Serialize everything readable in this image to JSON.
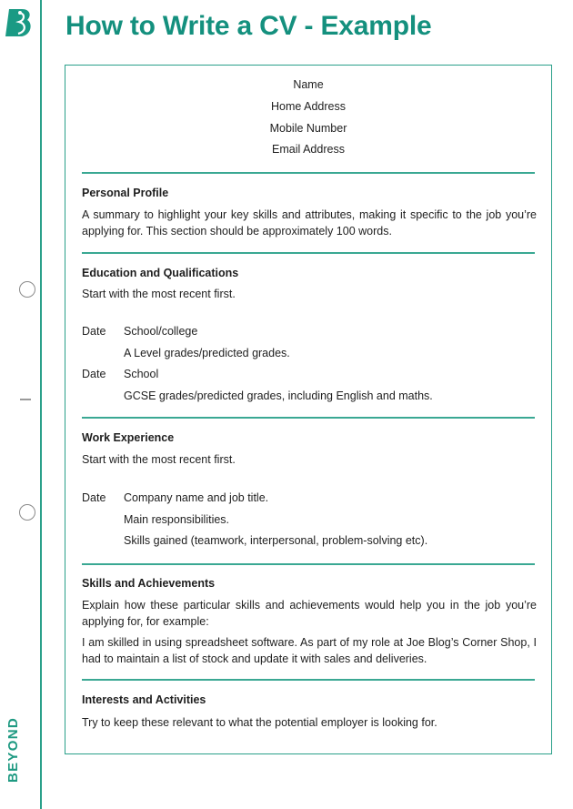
{
  "brand": {
    "logo_letter": "B",
    "side_label": "BEYOND",
    "accent_color": "#14907e"
  },
  "page": {
    "title": "How to Write a CV - Example"
  },
  "cv": {
    "header": [
      "Name",
      "Home Address",
      "Mobile Number",
      "Email Address"
    ],
    "personal_profile": {
      "title": "Personal Profile",
      "text": "A summary to highlight your key skills and attributes, making it specific to the job you’re applying for. This section should be approximately 100 words."
    },
    "education": {
      "title": "Education and Qualifications",
      "intro": "Start with the most recent first.",
      "entries": [
        {
          "date": "Date",
          "lines": [
            "School/college",
            "A Level grades/predicted grades."
          ]
        },
        {
          "date": "Date",
          "lines": [
            "School",
            "GCSE grades/predicted grades, including English and maths."
          ]
        }
      ]
    },
    "work": {
      "title": "Work Experience",
      "intro": "Start with the most recent first.",
      "entries": [
        {
          "date": "Date",
          "lines": [
            "Company name and job title.",
            "Main responsibilities.",
            "Skills gained (teamwork, interpersonal, problem-solving etc)."
          ]
        }
      ]
    },
    "skills": {
      "title": "Skills and Achievements",
      "text": "Explain how these particular skills and achievements would help you in the job you’re applying for, for example:",
      "example": "I am skilled in using spreadsheet software. As part of my role at Joe Blog’s Corner Shop, I had to maintain a list of stock and update it with sales and deliveries."
    },
    "interests": {
      "title": "Interests and Activities",
      "text": "Try to keep these relevant to what the potential employer is looking for."
    }
  }
}
